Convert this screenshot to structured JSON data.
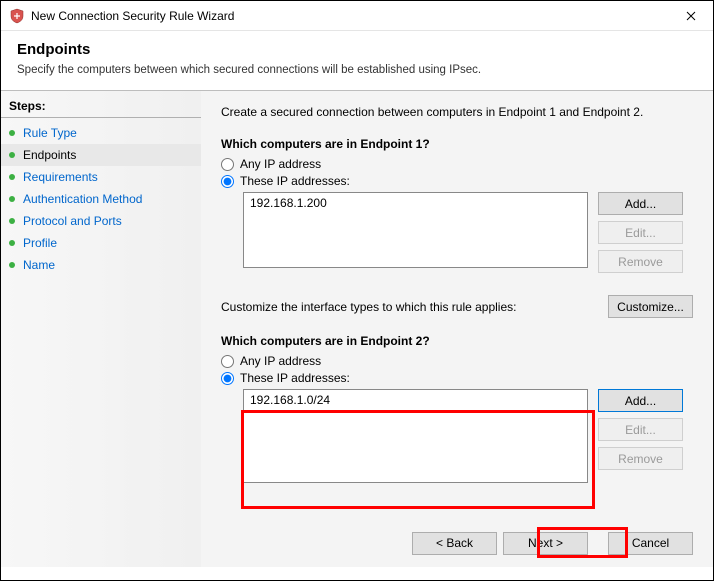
{
  "titlebar": {
    "title": "New Connection Security Rule Wizard"
  },
  "header": {
    "title": "Endpoints",
    "subtitle": "Specify the computers between which secured connections will be established using IPsec."
  },
  "steps": {
    "title": "Steps:",
    "items": [
      {
        "label": "Rule Type",
        "active": false
      },
      {
        "label": "Endpoints",
        "active": true
      },
      {
        "label": "Requirements",
        "active": false
      },
      {
        "label": "Authentication Method",
        "active": false
      },
      {
        "label": "Protocol and Ports",
        "active": false
      },
      {
        "label": "Profile",
        "active": false
      },
      {
        "label": "Name",
        "active": false
      }
    ]
  },
  "content": {
    "intro": "Create a secured connection between computers in Endpoint 1 and Endpoint 2.",
    "ep1": {
      "question": "Which computers are in Endpoint 1?",
      "any_label": "Any IP address",
      "these_label": "These IP addresses:",
      "selected": "these",
      "ips": [
        "192.168.1.200"
      ],
      "add": "Add...",
      "edit": "Edit...",
      "remove": "Remove"
    },
    "customize": {
      "text": "Customize the interface types to which this rule applies:",
      "button": "Customize..."
    },
    "ep2": {
      "question": "Which computers are in Endpoint 2?",
      "any_label": "Any IP address",
      "these_label": "These IP addresses:",
      "selected": "these",
      "ips": [
        "192.168.1.0/24"
      ],
      "add": "Add...",
      "edit": "Edit...",
      "remove": "Remove"
    }
  },
  "footer": {
    "back": "< Back",
    "next": "Next >",
    "cancel": "Cancel"
  }
}
